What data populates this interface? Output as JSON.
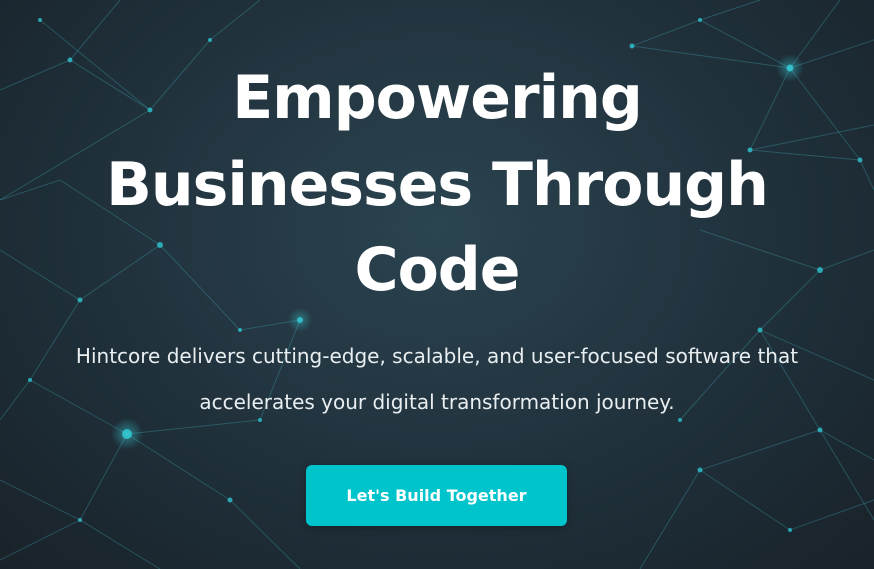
{
  "hero": {
    "headline_line1": "Empowering",
    "headline_line2": "Businesses Through",
    "headline_line3": "Code",
    "description_line1": "Hintcore delivers cutting-edge, scalable, and user-focused software that",
    "description_line2": "accelerates your digital transformation journey.",
    "cta_label": "Let's Build Together"
  },
  "colors": {
    "background": "#22343f",
    "network_line": "#3fa7b4",
    "network_node": "#2ec4cf",
    "cta_background": "#00c4cc",
    "text": "#ffffff"
  }
}
